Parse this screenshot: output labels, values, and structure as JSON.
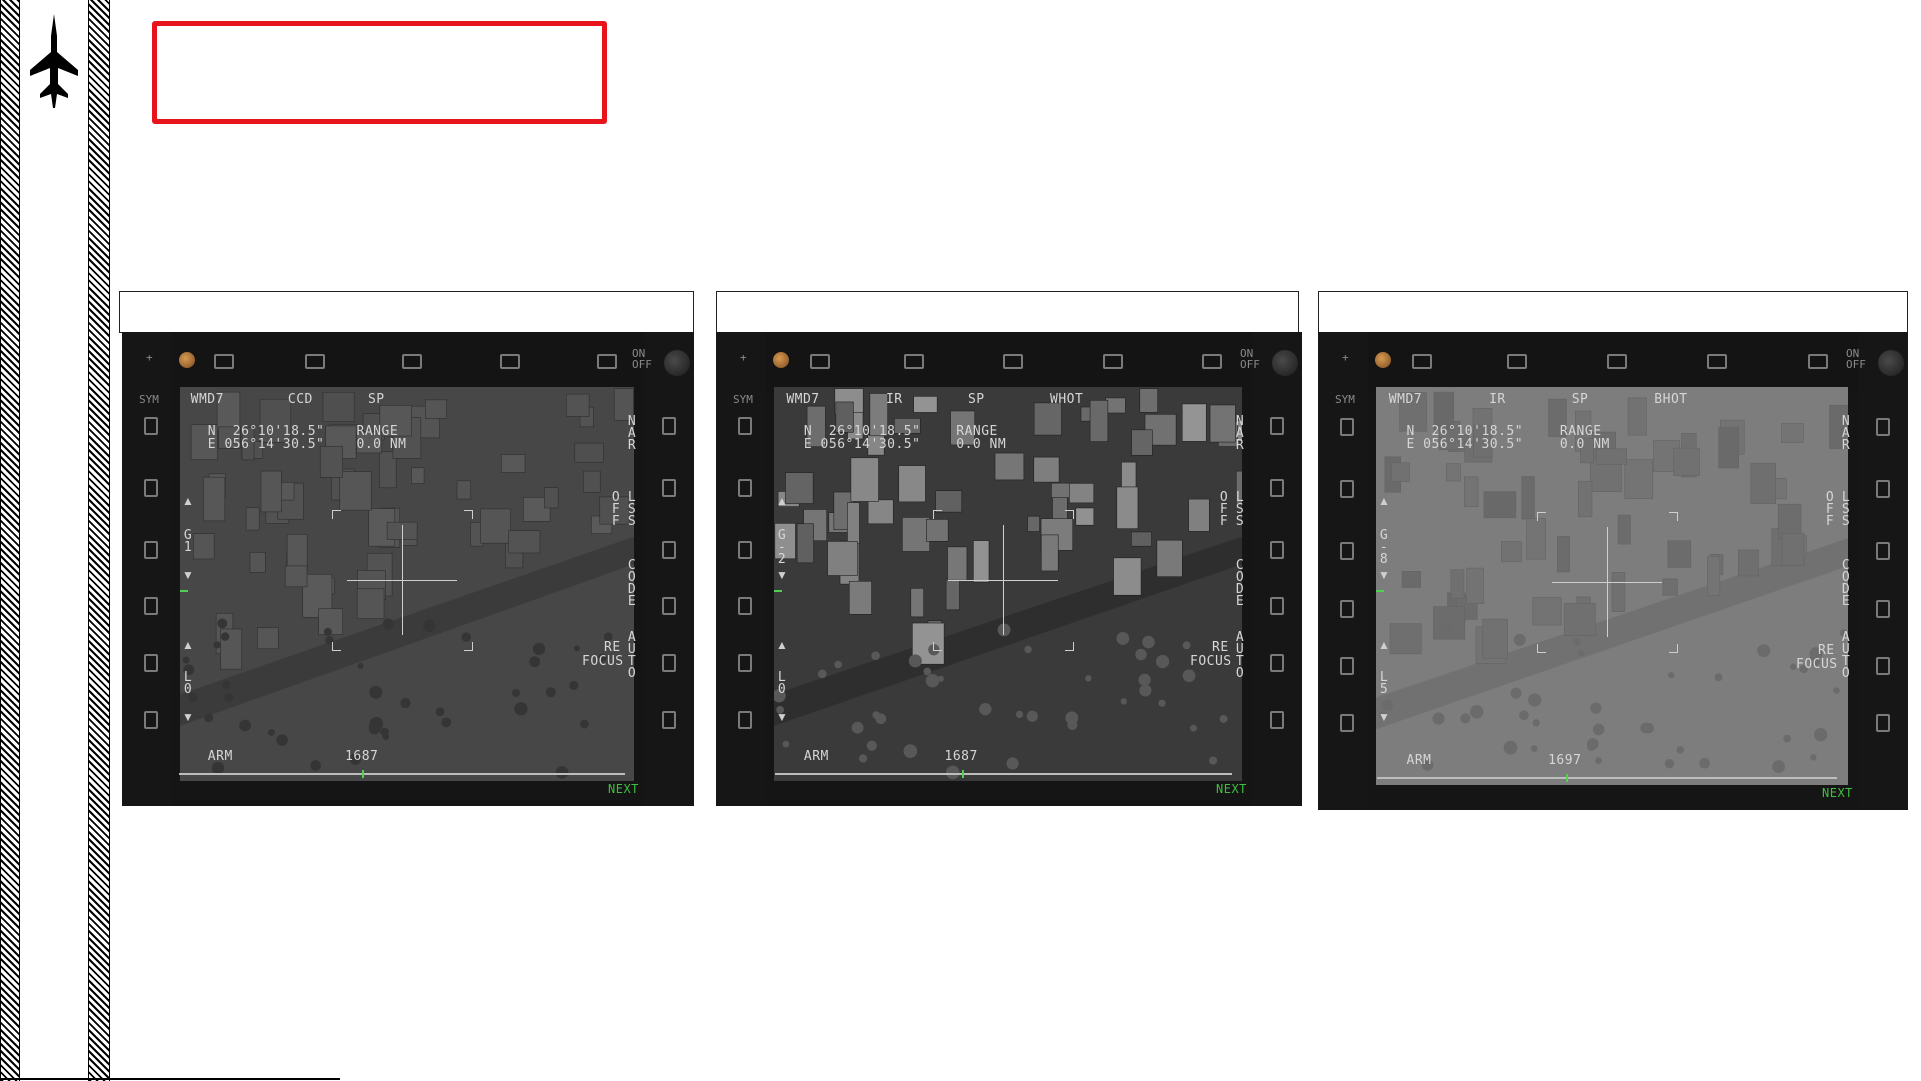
{
  "page": {
    "title_box_text": ""
  },
  "panels": [
    {
      "header": "",
      "mode_top": [
        "WMD7",
        "CCD",
        "SP",
        ""
      ],
      "coords": [
        "N  26°10'18.5\"",
        "E 056°14'30.5\""
      ],
      "range_label": "RANGE",
      "range_value": "0.0 NM",
      "right_labels": [
        "NAR",
        "OFF",
        "LSS",
        "CODE",
        "AUTO",
        "RE",
        "FOCUS"
      ],
      "left_labels": [
        "SYM",
        "G1",
        "L0"
      ],
      "gain_value": "1",
      "level_value": "0",
      "arm_label": "ARM",
      "scale_value": "1687",
      "next_label": "NEXT",
      "on_off": [
        "ON",
        "OFF"
      ],
      "tone": "#474747"
    },
    {
      "header": "",
      "mode_top": [
        "WMD7",
        "IR",
        "SP",
        "WHOT"
      ],
      "coords": [
        "N  26°10'18.5\"",
        "E 056°14'30.5\""
      ],
      "range_label": "RANGE",
      "range_value": "0.0 NM",
      "right_labels": [
        "NAR",
        "OFF",
        "LSS",
        "CODE",
        "AUTO",
        "RE",
        "FOCUS"
      ],
      "left_labels": [
        "SYM",
        "G-2",
        "L0"
      ],
      "gain_value": "-2",
      "level_value": "0",
      "arm_label": "ARM",
      "scale_value": "1687",
      "next_label": "NEXT",
      "on_off": [
        "ON",
        "OFF"
      ],
      "tone": "#3a3a3a"
    },
    {
      "header": "",
      "mode_top": [
        "WMD7",
        "IR",
        "SP",
        "BHOT"
      ],
      "coords": [
        "N  26°10'18.5\"",
        "E 056°14'30.5\""
      ],
      "range_label": "RANGE",
      "range_value": "0.0 NM",
      "right_labels": [
        "NAR",
        "OFF",
        "LSS",
        "CODE",
        "AUTO",
        "RE",
        "FOCUS"
      ],
      "left_labels": [
        "SYM",
        "G-8",
        "L5"
      ],
      "gain_value": "-8",
      "level_value": "5",
      "arm_label": "ARM",
      "scale_value": "1697",
      "next_label": "NEXT",
      "on_off": [
        "ON",
        "OFF"
      ],
      "tone": "#7d7d7d"
    }
  ]
}
